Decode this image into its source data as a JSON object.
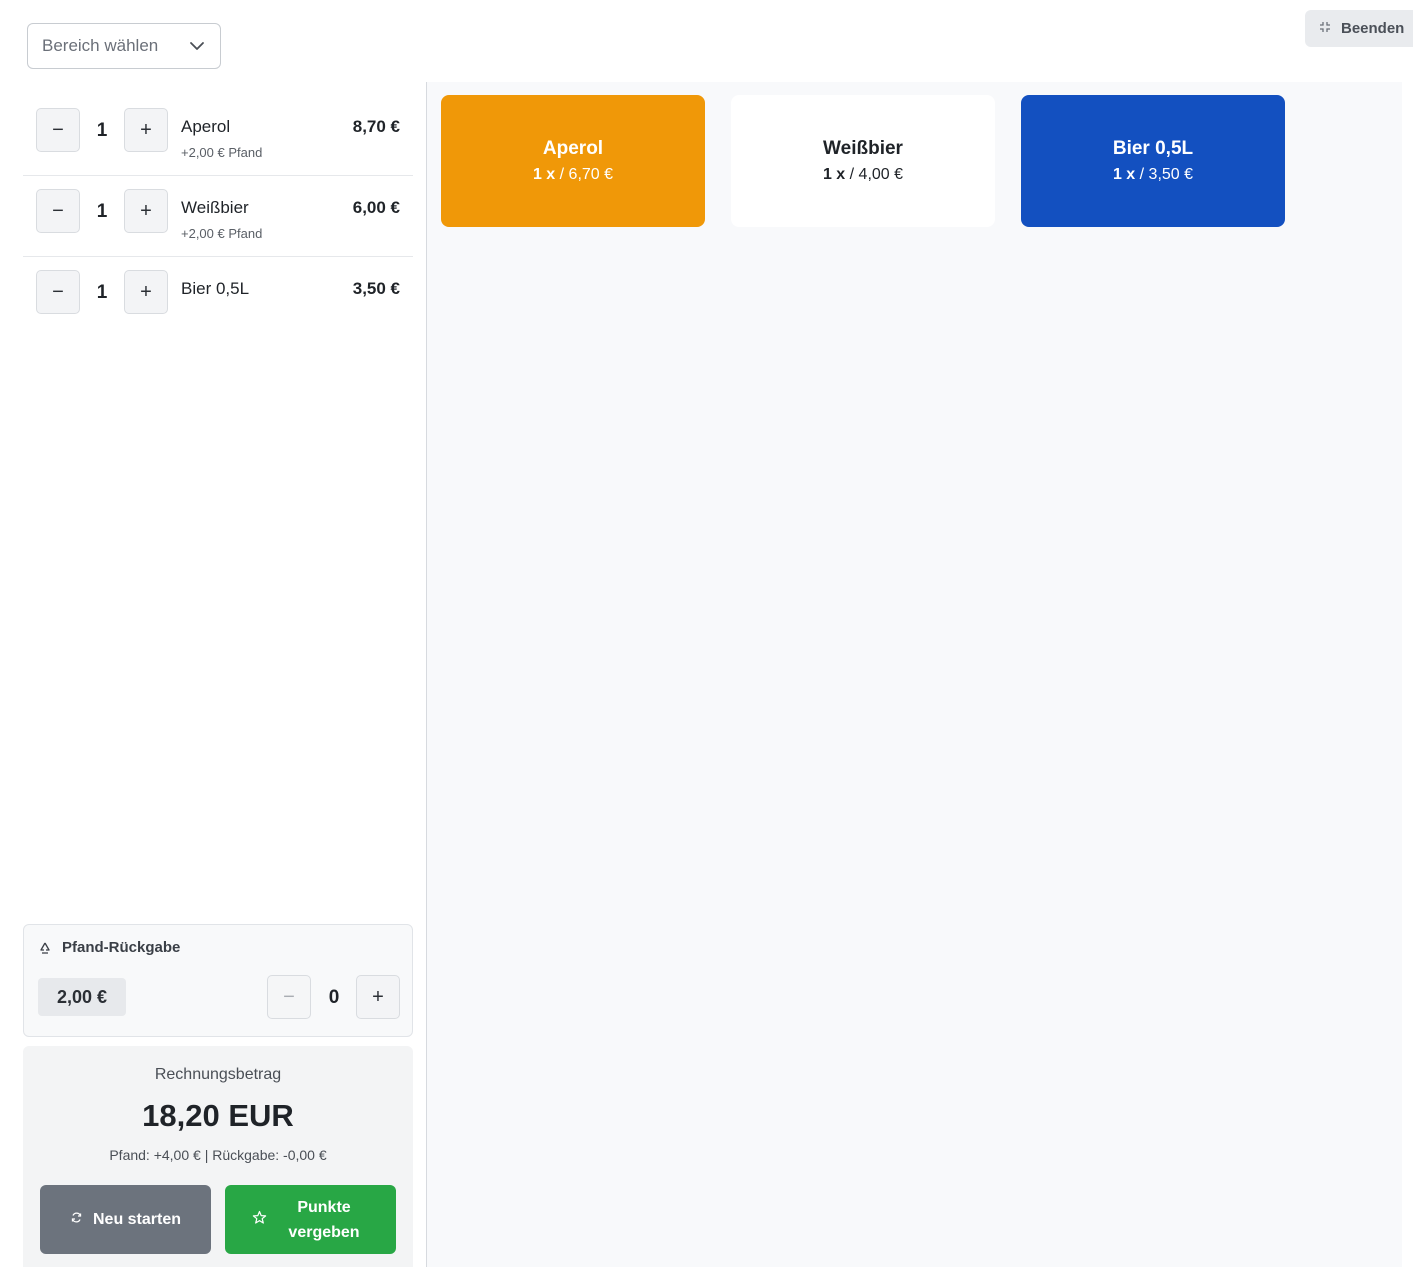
{
  "header": {
    "area_select": {
      "value": "Bereich wählen"
    },
    "end_button": {
      "label": "Beenden"
    }
  },
  "cart": {
    "items": [
      {
        "qty": "1",
        "name": "Aperol",
        "deposit": "+2,00 € Pfand",
        "price": "8,70 €"
      },
      {
        "qty": "1",
        "name": "Weißbier",
        "deposit": "+2,00 € Pfand",
        "price": "6,00 €"
      },
      {
        "qty": "1",
        "name": "Bier 0,5L",
        "deposit": "",
        "price": "3,50 €"
      }
    ]
  },
  "deposit_return": {
    "title": "Pfand-Rückgabe",
    "value": "2,00 €",
    "qty": "0"
  },
  "totals": {
    "label": "Rechnungsbetrag",
    "amount": "18,20 EUR",
    "detail": "Pfand: +4,00 € | Rückgabe: -0,00 €",
    "restart_label": "Neu starten",
    "points_label": "Punkte vergeben"
  },
  "products": [
    {
      "name": "Aperol",
      "count": "1 x",
      "price": "/ 6,70 €",
      "bg": "#f09808",
      "fg": "#ffffff"
    },
    {
      "name": "Weißbier",
      "count": "1 x",
      "price": "/ 4,00 €",
      "bg": "#ffffff",
      "fg": "#1f2328"
    },
    {
      "name": "Bier 0,5L",
      "count": "1 x",
      "price": "/ 3,50 €",
      "bg": "#1350c0",
      "fg": "#ffffff"
    }
  ],
  "colors": {
    "restart_button": "#6c737d",
    "points_button": "#28a745"
  },
  "icons": {
    "select": "chevron-down-icon",
    "end": "minimize-icon",
    "deposit": "recycle-icon",
    "restart": "refresh-icon",
    "points": "star-icon"
  }
}
